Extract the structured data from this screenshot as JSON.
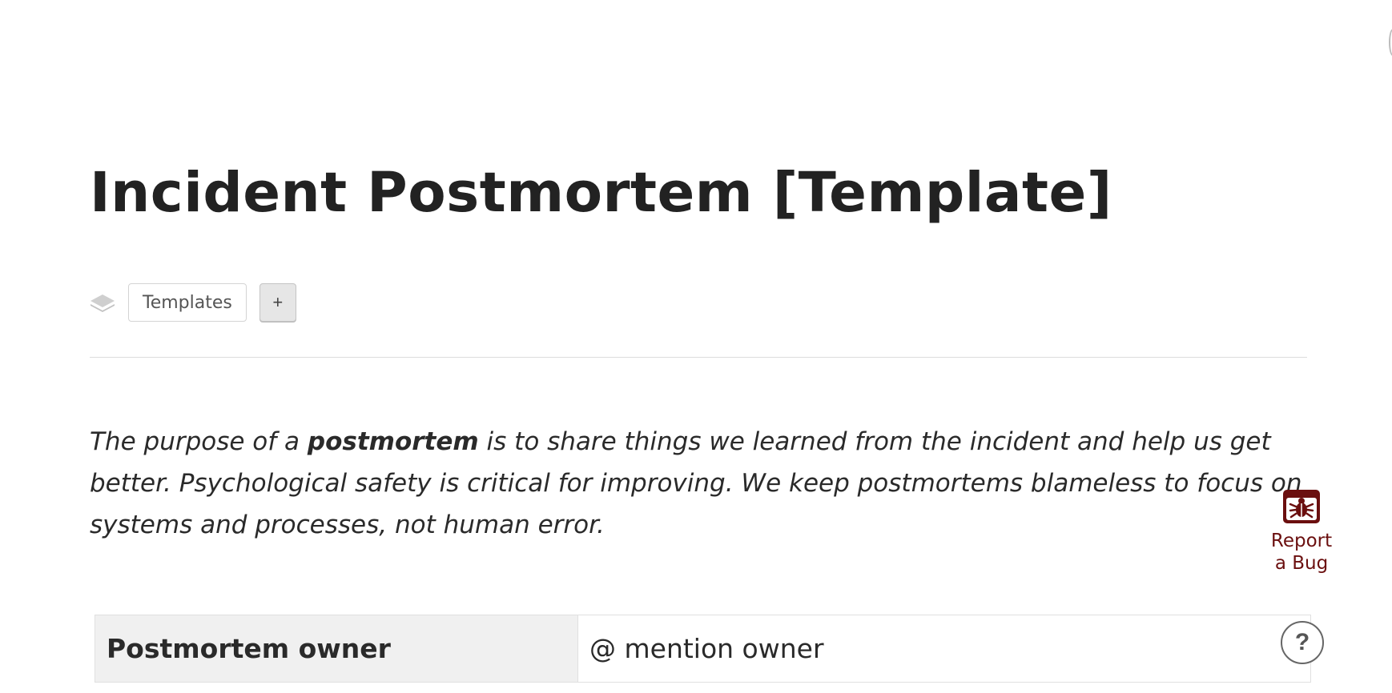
{
  "page": {
    "title": "Incident Postmortem [Template]"
  },
  "tags": {
    "icon": "stack-layers-icon",
    "items": [
      {
        "label": "Templates"
      }
    ],
    "add_label": "+"
  },
  "intro": {
    "part1": "The purpose of a ",
    "bold": "postmortem",
    "part2": " is to share things we learned from the incident and help us get better. Psychological safety is critical for improving. We keep postmortems blameless to focus on systems and processes, not human error."
  },
  "properties": {
    "rows": [
      {
        "key": "Postmortem owner",
        "value": "@ mention owner"
      }
    ]
  },
  "report_bug": {
    "icon": "bug-icon",
    "label_line1": "Report",
    "label_line2": "a Bug",
    "color": "#6b0f0f"
  },
  "help": {
    "label": "?",
    "icon": "question-icon"
  }
}
